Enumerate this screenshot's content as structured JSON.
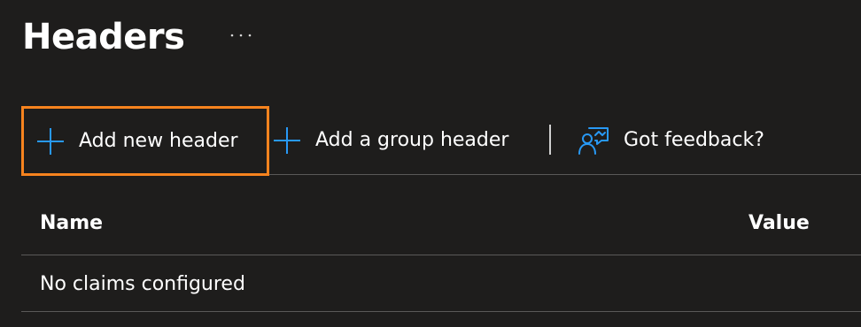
{
  "page": {
    "title": "Headers",
    "more_icon": "ellipsis-icon"
  },
  "toolbar": {
    "add_new_label": "Add new header",
    "add_group_label": "Add a group header",
    "feedback_label": "Got feedback?",
    "add_icon": "plus-icon",
    "feedback_icon": "feedback-person-icon"
  },
  "table": {
    "columns": [
      "Name",
      "Value"
    ],
    "empty_message": "No claims configured"
  },
  "colors": {
    "background": "#1e1d1c",
    "accent": "#2899f5",
    "highlight": "#f7831e"
  }
}
